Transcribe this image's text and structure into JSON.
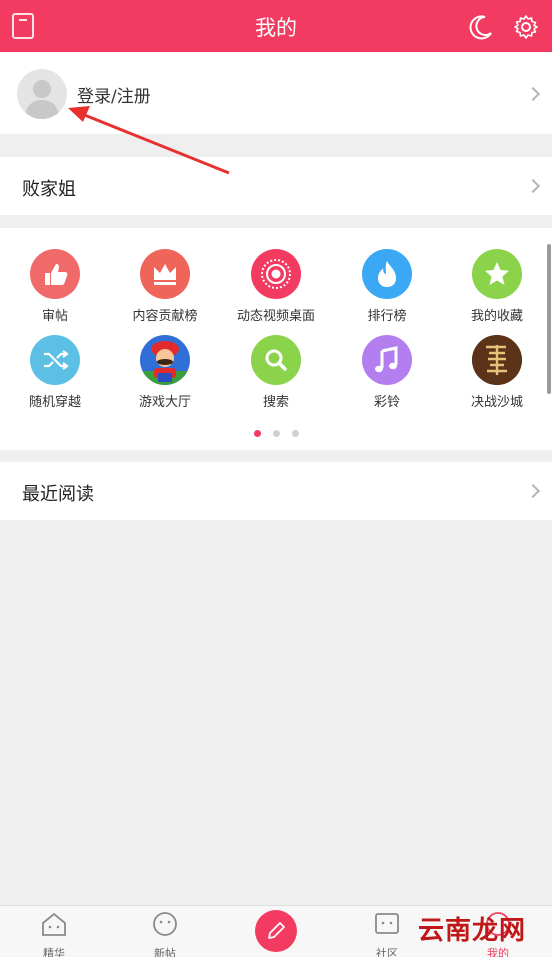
{
  "header": {
    "title": "我的"
  },
  "login": {
    "label": "登录/注册"
  },
  "baijia": {
    "label": "败家姐"
  },
  "grid": {
    "items": [
      {
        "label": "审帖",
        "icon": "thumbs-up-icon",
        "color": "#f16a6a"
      },
      {
        "label": "内容贡献榜",
        "icon": "crown-icon",
        "color": "#f0655a"
      },
      {
        "label": "动态视频桌面",
        "icon": "video-ring-icon",
        "color": "#f33b62"
      },
      {
        "label": "排行榜",
        "icon": "flame-icon",
        "color": "#3aa8f5"
      },
      {
        "label": "我的收藏",
        "icon": "star-icon",
        "color": "#8bd34a"
      },
      {
        "label": "随机穿越",
        "icon": "shuffle-icon",
        "color": "#5bc0e3"
      },
      {
        "label": "游戏大厅",
        "icon": "mario-game-icon",
        "color": "#2f6fd6"
      },
      {
        "label": "搜索",
        "icon": "search-icon",
        "color": "#8bd34a"
      },
      {
        "label": "彩铃",
        "icon": "music-note-icon",
        "color": "#b37ef0"
      },
      {
        "label": "决战沙城",
        "icon": "dragon-game-icon",
        "color": "#4a2a14"
      }
    ],
    "page_dots": 3,
    "active_dot": 1
  },
  "recent": {
    "label": "最近阅读"
  },
  "tabbar": {
    "tabs": [
      {
        "label": "精华",
        "icon": "home-face-icon"
      },
      {
        "label": "新帖",
        "icon": "smile-icon"
      },
      {
        "label": "",
        "icon": "pencil-icon"
      },
      {
        "label": "社区",
        "icon": "tv-face-icon"
      },
      {
        "label": "我的",
        "icon": "profile-icon"
      }
    ],
    "active": "我的"
  },
  "watermark": {
    "text": "云南龙网"
  },
  "colors": {
    "accent": "#f33b62",
    "background": "#efefef"
  }
}
